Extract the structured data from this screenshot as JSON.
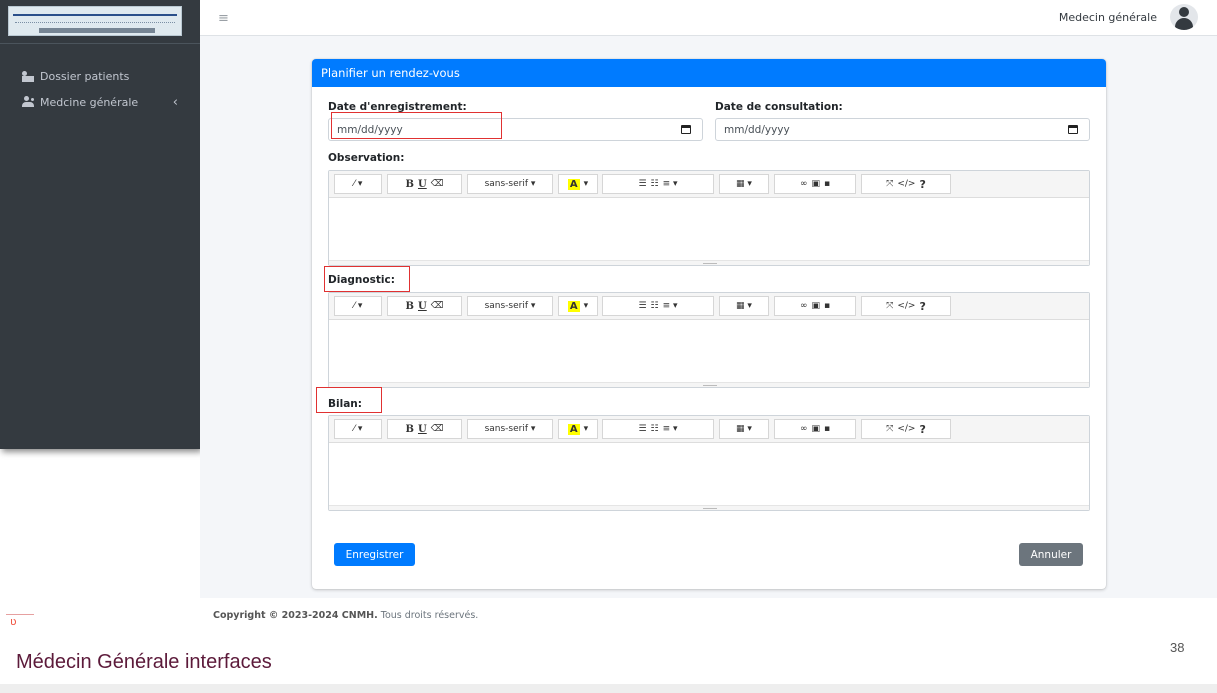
{
  "sidebar": {
    "items": [
      {
        "label": "Dossier patients",
        "icon": "id-card-icon"
      },
      {
        "label": "Medcine générale",
        "icon": "users-icon",
        "chevron": "‹"
      }
    ]
  },
  "topbar": {
    "menu_glyph": "≡",
    "user_name": "Medecin générale"
  },
  "form": {
    "title": "Planifier un rendez-vous",
    "date_enregistrement": {
      "label": "Date d'enregistrement:",
      "placeholder": "mm/dd/yyyy"
    },
    "date_consultation": {
      "label": "Date de consultation:",
      "placeholder": "mm/dd/yyyy"
    },
    "observation_label": "Observation:",
    "diagnostic_label": "Diagnostic:",
    "bilan_label": "Bilan:",
    "toolbar": {
      "magic": "⁄ ▾",
      "bold": "B",
      "underline": "U",
      "eraser": "⌫",
      "font": "sans-serif ▾",
      "color": "A",
      "color_caret": "▾",
      "ul": "☰",
      "ol": "☷",
      "align": "≡ ▾",
      "table": "▦ ▾",
      "link": "∞",
      "picture": "▣",
      "video": "▪",
      "fullscreen": "⤧",
      "code": "</>",
      "help": "?"
    },
    "save_label": "Enregistrer",
    "cancel_label": "Annuler"
  },
  "footer": {
    "copyright_bold": "Copyright © 2023-2024 CNMH.",
    "copyright_rest": " Tous droits réservés."
  },
  "slide": {
    "title": "Médecin Générale interfaces",
    "page_number": "38"
  },
  "colors": {
    "primary": "#007bff",
    "sidebar": "#343a40",
    "secondary": "#6c757d",
    "highlight": "#e03131"
  }
}
